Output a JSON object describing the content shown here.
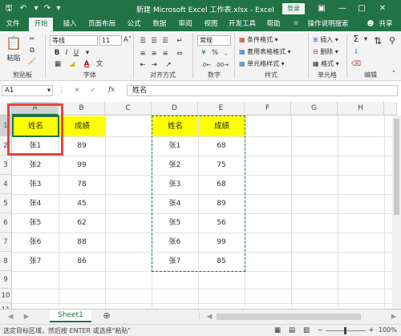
{
  "window": {
    "title": "新建 Microsoft Excel 工作表.xlsx  -  Excel",
    "login_label": "登录"
  },
  "menu_tabs": [
    "文件",
    "开始",
    "插入",
    "页面布局",
    "公式",
    "数据",
    "审阅",
    "视图",
    "开发工具",
    "帮助"
  ],
  "tell_me": "操作说明搜索",
  "share": "共享",
  "ribbon": {
    "paste_label": "粘贴",
    "font_name": "等线",
    "font_size": "11",
    "number_format": "常规",
    "conditional_format": "条件格式",
    "table_format": "套用表格格式",
    "cell_styles": "单元格样式",
    "insert": "插入",
    "delete": "删除",
    "format": "格式",
    "groups": {
      "clipboard": "剪贴板",
      "font": "字体",
      "alignment": "对齐方式",
      "number": "数字",
      "styles": "样式",
      "cells": "单元格",
      "editing": "编辑"
    }
  },
  "formula_bar": {
    "name_box": "A1",
    "fx": "fx",
    "content": "姓名"
  },
  "columns": [
    "A",
    "B",
    "C",
    "D",
    "E",
    "F",
    "G",
    "H"
  ],
  "rows": [
    "1",
    "2",
    "3",
    "4",
    "5",
    "6",
    "7",
    "8",
    "9",
    "10",
    "11"
  ],
  "table_left": {
    "headers": [
      "姓名",
      "成绩"
    ],
    "rows": [
      [
        "张1",
        "89"
      ],
      [
        "张2",
        "99"
      ],
      [
        "张3",
        "78"
      ],
      [
        "张4",
        "45"
      ],
      [
        "张5",
        "62"
      ],
      [
        "张6",
        "88"
      ],
      [
        "张7",
        "86"
      ]
    ]
  },
  "table_right": {
    "headers": [
      "姓名",
      "成绩"
    ],
    "rows": [
      [
        "张1",
        "68"
      ],
      [
        "张2",
        "75"
      ],
      [
        "张3",
        "68"
      ],
      [
        "张4",
        "89"
      ],
      [
        "张5",
        "56"
      ],
      [
        "张6",
        "99"
      ],
      [
        "张7",
        "85"
      ]
    ]
  },
  "sheet_tab": "Sheet1",
  "status_text": "选定目标区域，然后按 ENTER 或选择\"粘贴\"",
  "zoom": "100%",
  "colors": {
    "excel_green": "#217346",
    "header_fill": "#ffff00",
    "highlight_red": "#e8453c"
  }
}
